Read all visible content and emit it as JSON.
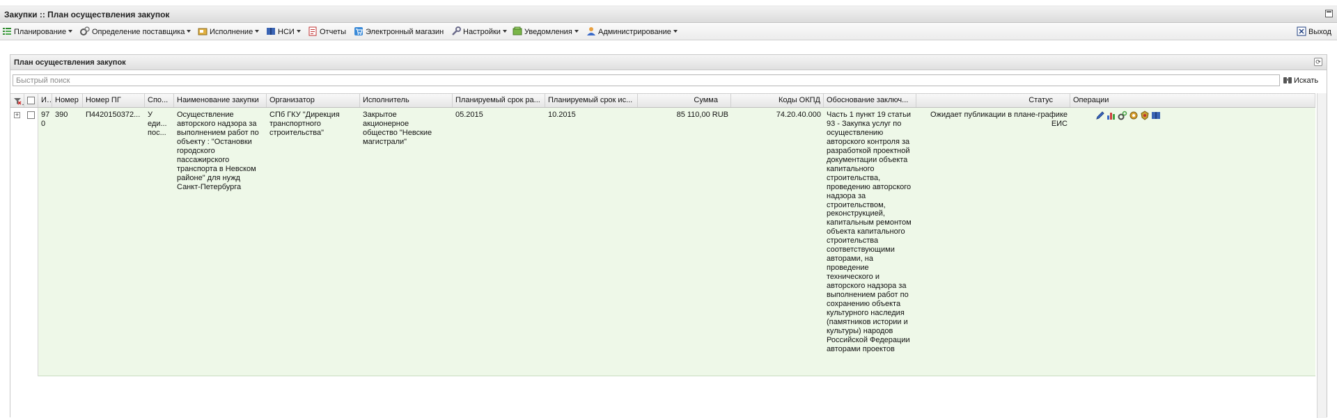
{
  "window": {
    "title": "Закупки :: План осуществления закупок"
  },
  "menu": {
    "items": [
      {
        "label": "Планирование",
        "icon": "planning-icon",
        "has_dropdown": true
      },
      {
        "label": "Определение поставщика",
        "icon": "supplier-gears-icon",
        "has_dropdown": true
      },
      {
        "label": "Исполнение",
        "icon": "execution-icon",
        "has_dropdown": true
      },
      {
        "label": "НСИ",
        "icon": "book-icon",
        "has_dropdown": true
      },
      {
        "label": "Отчеты",
        "icon": "report-icon",
        "has_dropdown": false
      },
      {
        "label": "Электронный магазин",
        "icon": "cart-icon",
        "has_dropdown": false
      },
      {
        "label": "Настройки",
        "icon": "wrench-icon",
        "has_dropdown": true
      },
      {
        "label": "Уведомления",
        "icon": "notification-icon",
        "has_dropdown": true
      },
      {
        "label": "Администрирование",
        "icon": "user-admin-icon",
        "has_dropdown": true
      }
    ],
    "logout_label": "Выход"
  },
  "panel": {
    "title": "План осуществления закупок"
  },
  "search": {
    "placeholder": "Быстрый поиск",
    "button_label": "Искать"
  },
  "grid": {
    "columns": [
      "Иде",
      "Номер",
      "Номер ПГ",
      "Спо...",
      "Наименование закупки",
      "Организатор",
      "Исполнитель",
      "Планируемый срок ра...",
      "Планируемый срок ис...",
      "Сумма",
      "Коды ОКПД",
      "Обоснование заключ...",
      "Статус",
      "Операции"
    ],
    "rows": [
      {
        "id": "970",
        "number": "390",
        "pg_number": "П4420150372...",
        "method": "У еди... пос...",
        "name": "Осуществление авторского надзора за выполнением работ по объекту : \"Остановки городского пассажирского транспорта в Невском районе\" для нужд Санкт-Петербурга",
        "organizer": "СПб ГКУ \"Дирекция транспортного строительства\"",
        "executor": "Закрытое акционерное общество \"Невские магистрали\"",
        "planned_start": "05.2015",
        "planned_end": "10.2015",
        "sum": "85 110,00 RUB",
        "okpd": "74.20.40.000",
        "justification": "Часть 1 пункт 19 статьи 93 - Закупка услуг по осуществлению авторского контроля за разработкой проектной документации объекта капитального строительства, проведению авторского надзора за строительством, реконструкцией, капитальным ремонтом объекта капитального строительства соответствующими авторами, на проведение технического и авторского надзора за выполнением работ по сохранению объекта культурного наследия (памятников истории и культуры) народов Российской Федерации авторами проектов",
        "status": "Ожидает публикации в плане-графике ЕИС",
        "operations": [
          "edit-icon",
          "chart-icon",
          "gears-icon",
          "gear-icon",
          "emblem-icon",
          "book-icon"
        ]
      }
    ]
  }
}
